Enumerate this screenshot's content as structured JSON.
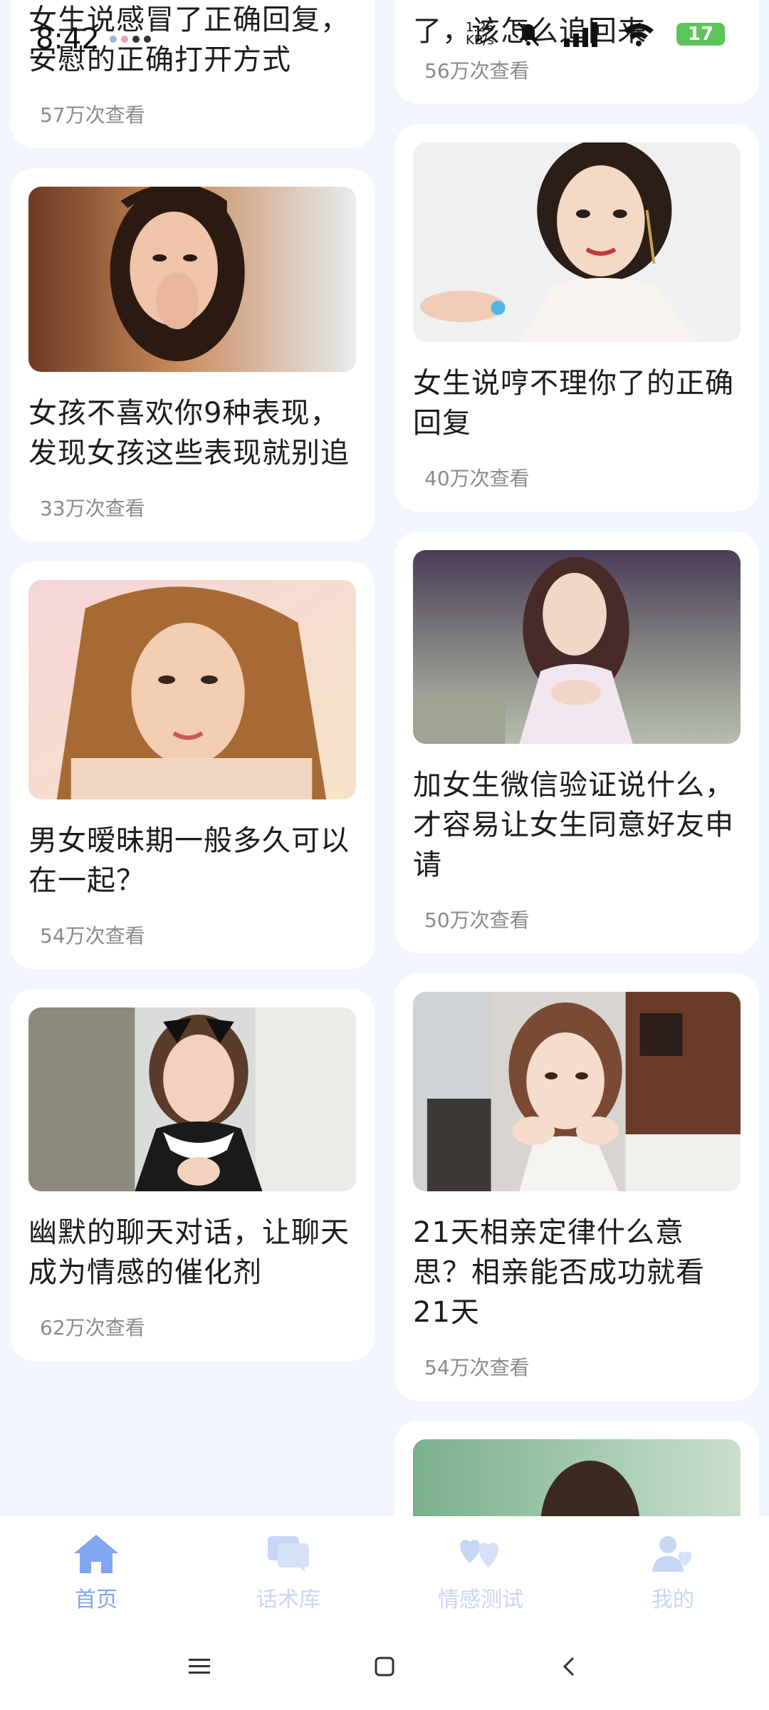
{
  "status_bar": {
    "time": "8:42",
    "net_speed_value": "1.26",
    "net_speed_unit": "KB/s",
    "battery": "17"
  },
  "feed": {
    "left": [
      {
        "title": "女生说感冒了正确回复，安慰的正确打开方式",
        "views": "57万次查看",
        "image": "top-cut-image"
      },
      {
        "title": "女孩不喜欢你9种表现，发现女孩这些表现就别追",
        "views": "33万次查看",
        "image": "woman-hand-portrait"
      },
      {
        "title": "男女暧昧期一般多久可以在一起？",
        "views": "54万次查看",
        "image": "woman-lying-portrait"
      },
      {
        "title": "幽默的聊天对话，让聊天成为情感的催化剂",
        "views": "62万次查看",
        "image": "maid-costume-portrait"
      }
    ],
    "right": [
      {
        "title": "了，该怎么追回来",
        "views": "56万次查看"
      },
      {
        "title": "女生说哼不理你了的正确回复",
        "views": "40万次查看",
        "image": "woman-smiling-pointing"
      },
      {
        "title": "加女生微信验证说什么，才容易让女生同意好友申请",
        "views": "50万次查看",
        "image": "woman-outdoor-portrait"
      },
      {
        "title": "21天相亲定律什么意思？相亲能否成功就看21天",
        "views": "54万次查看",
        "image": "woman-hands-on-face"
      },
      {
        "title": "",
        "views": "",
        "image": "woman-green-background"
      }
    ]
  },
  "bottom_nav": [
    {
      "label": "首页",
      "icon": "home-icon",
      "active": true
    },
    {
      "label": "话术库",
      "icon": "chat-bubbles-icon",
      "active": false
    },
    {
      "label": "情感测试",
      "icon": "hearts-icon",
      "active": false
    },
    {
      "label": "我的",
      "icon": "user-heart-icon",
      "active": false
    }
  ],
  "colors": {
    "accent": "#7fa6f0",
    "accent_inactive": "#c7d7f5",
    "background": "#f1f6fd",
    "card": "#ffffff"
  }
}
